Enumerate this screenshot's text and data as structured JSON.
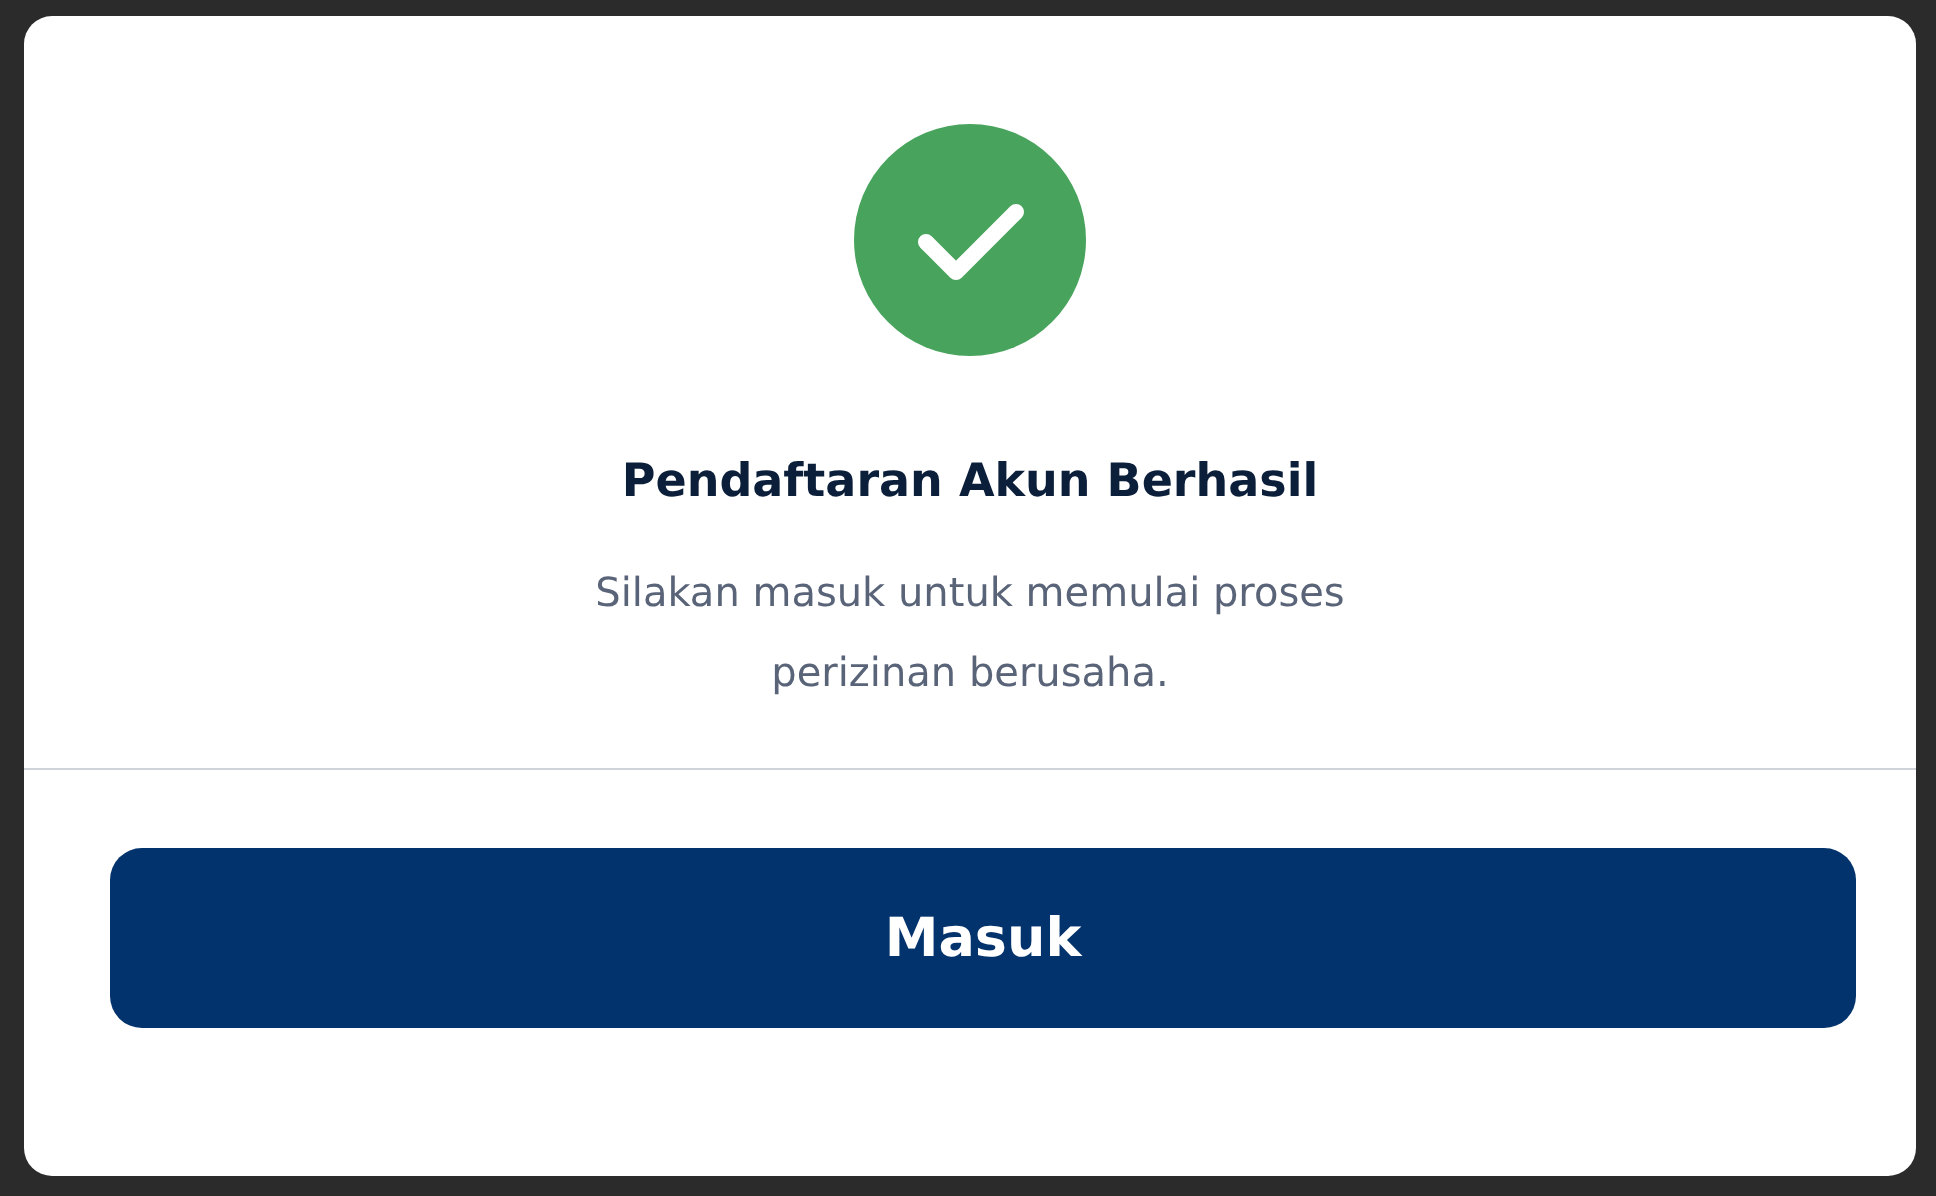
{
  "dialog": {
    "title": "Pendaftaran Akun Berhasil",
    "message": "Silakan masuk untuk memulai proses perizinan berusaha.",
    "buttons": [
      "Masuk"
    ]
  }
}
